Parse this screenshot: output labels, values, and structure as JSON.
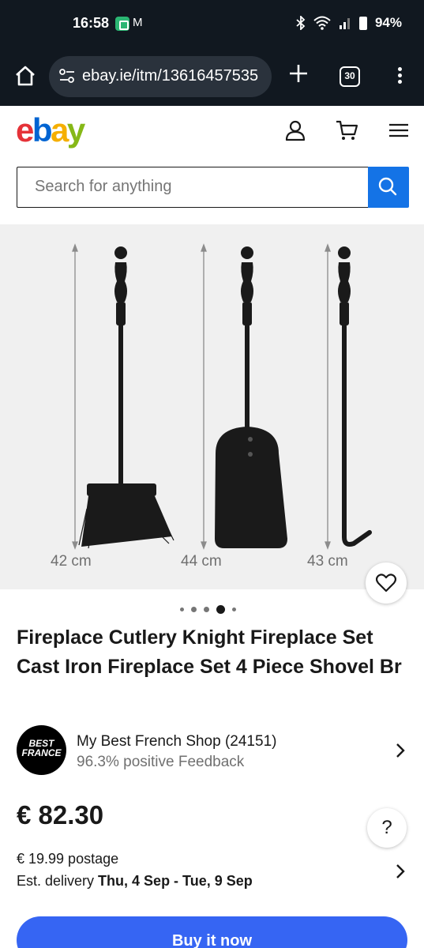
{
  "status_bar": {
    "time": "16:58",
    "mail_glyph": "M",
    "battery": "94%"
  },
  "browser": {
    "url": "ebay.ie/itm/13616457535",
    "tab_count": "30"
  },
  "site": {
    "logo": [
      "e",
      "b",
      "a",
      "y"
    ]
  },
  "search": {
    "placeholder": "Search for anything"
  },
  "gallery": {
    "dimensions": [
      "42 cm",
      "44 cm",
      "43 cm"
    ],
    "image_count": 5,
    "active_index": 3
  },
  "product": {
    "title": "Fireplace Cutlery Knight Fireplace Set Cast Iron Fireplace Set 4 Piece Shovel Br",
    "price": "€ 82.30",
    "postage": "€ 19.99 postage",
    "delivery_prefix": "Est. delivery ",
    "delivery_dates": "Thu, 4 Sep - Tue, 9 Sep",
    "buy_label": "Buy it now"
  },
  "seller": {
    "logo_line1": "BEST",
    "logo_line2": "FRANCE",
    "name": "My Best French Shop (24151)",
    "feedback": "96.3% positive Feedback"
  },
  "help": {
    "label": "?"
  },
  "colors": {
    "ebay_red": "#e53238",
    "ebay_blue": "#0064d2",
    "ebay_yellow": "#f5af02",
    "ebay_green": "#86b817",
    "cta_blue": "#3665f3",
    "search_blue": "#1473e6"
  }
}
